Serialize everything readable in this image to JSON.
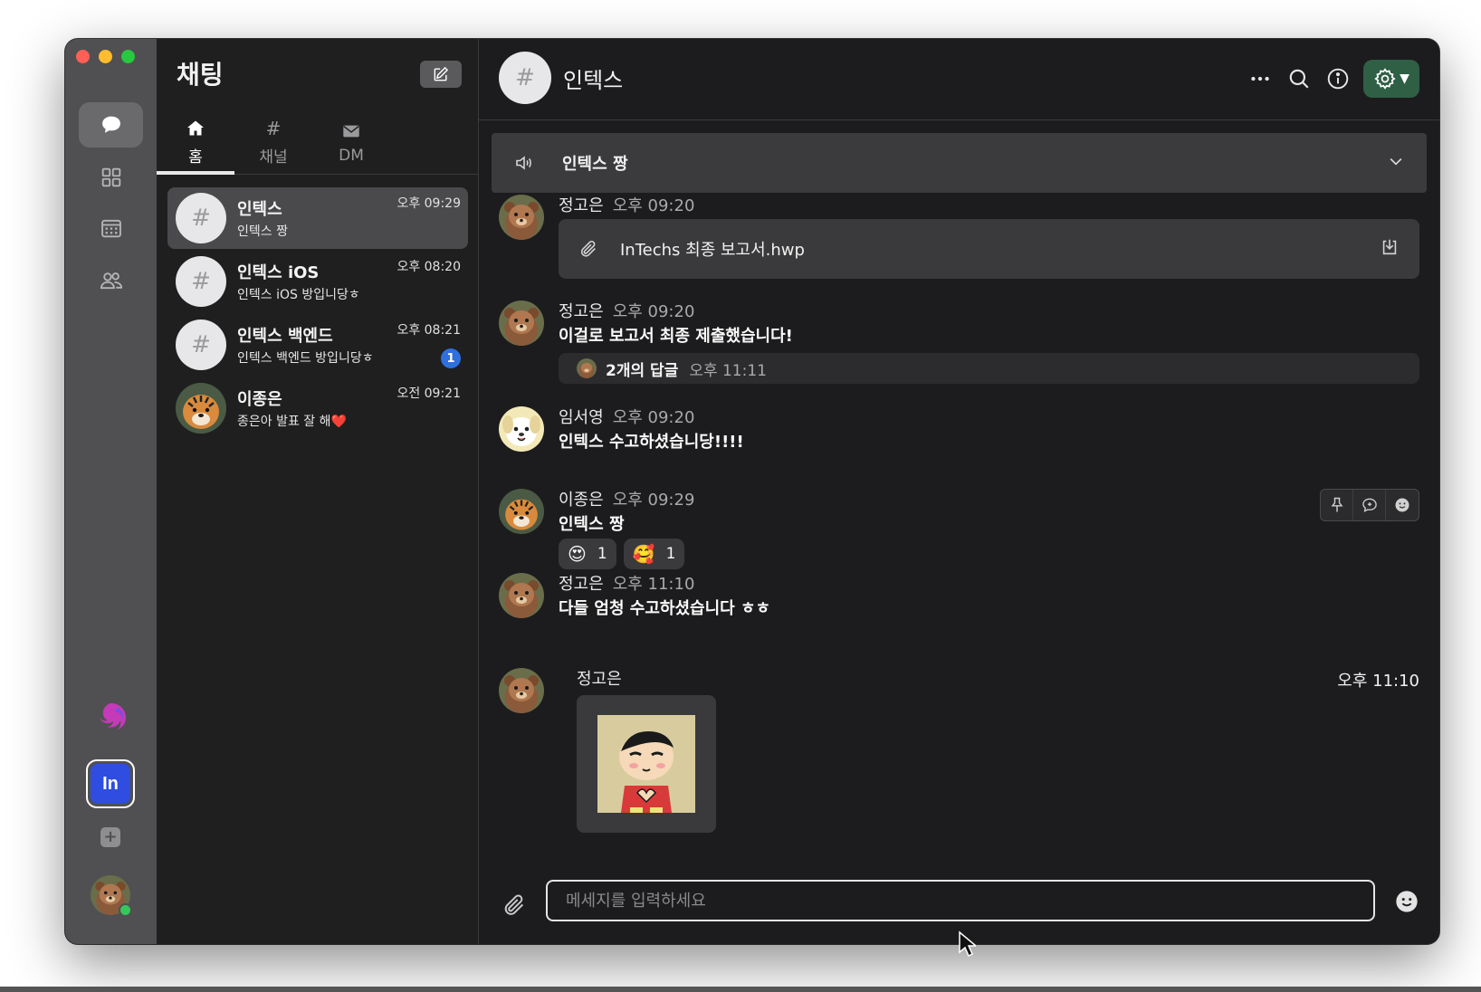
{
  "sidebar": {
    "title": "채팅",
    "tabs": [
      {
        "icon": "home-icon",
        "label": "홈",
        "active": true
      },
      {
        "icon": "hash-icon",
        "label": "채널",
        "active": false
      },
      {
        "icon": "envelope-icon",
        "label": "DM",
        "active": false
      }
    ],
    "chats": [
      {
        "name": "인텍스",
        "preview": "인텍스 짱",
        "time": "오후 09:29",
        "active": true,
        "avatar": "#"
      },
      {
        "name": "인텍스 iOS",
        "preview": "인텍스 iOS 방입니당ㅎ",
        "time": "오후 08:20",
        "active": false,
        "avatar": "#"
      },
      {
        "name": "인텍스 백엔드",
        "preview": "인텍스 백엔드 방입니당ㅎ",
        "time": "오후 08:21",
        "badge": "1",
        "active": false,
        "avatar": "#"
      },
      {
        "name": "이종은",
        "preview": "종은아 발표 잘 해❤️",
        "time": "오전 09:21",
        "active": false,
        "avatar": "tiger-avatar"
      }
    ]
  },
  "rail": {
    "workspace_label": "In"
  },
  "channel": {
    "avatar": "#",
    "title": "인텍스",
    "notice": "인텍스 짱"
  },
  "messages": [
    {
      "author": "정고은",
      "time": "오후 09:20",
      "file_name": "InTechs 최종 보고서.hwp"
    },
    {
      "author": "정고은",
      "time": "오후 09:20",
      "text": "이걸로 보고서 최종 제출했습니다!",
      "thread_count": "2개의 답글",
      "thread_time": "오후 11:11"
    },
    {
      "author": "임서영",
      "time": "오후 09:20",
      "text": "인텍스 수고하셨습니당!!!!"
    },
    {
      "author": "이종은",
      "time": "오후 09:29",
      "text": "인텍스 짱",
      "reactions": [
        {
          "emoji": "😍",
          "count": "1"
        },
        {
          "emoji": "🥰",
          "count": "1"
        }
      ]
    },
    {
      "author": "정고은",
      "time": "오후 11:10",
      "text": "다들 엄청 수고하셨습니다 ㅎㅎ"
    },
    {
      "author": "정고은",
      "time": "오후 11:10",
      "sticker": "shinchan-sticker"
    }
  ],
  "composer": {
    "placeholder": "메세지를 입력하세요"
  },
  "colors": {
    "rail_bg": "#505052",
    "sidebar_bg": "#1f1f20",
    "main_bg": "#1c1c1e",
    "settings_accent": "#2f5f45",
    "workspace_accent": "#2f4de0",
    "badge_blue": "#2f6fe0"
  }
}
